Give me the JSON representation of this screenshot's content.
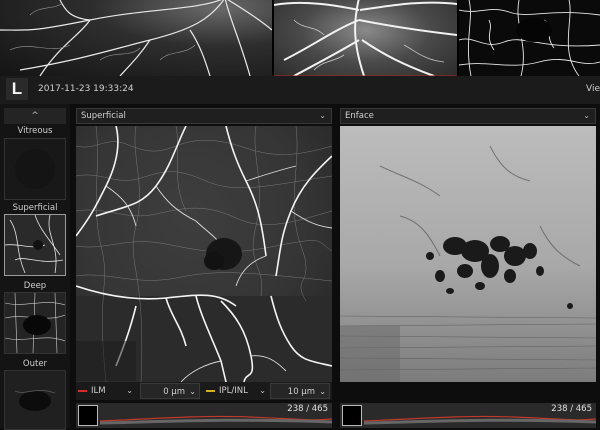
{
  "header": {
    "logo_letter": "L",
    "timestamp": "2017-11-23 19:33:24",
    "right_label": "Vie"
  },
  "sidebar": {
    "scroll_up_icon": "chevron-up-icon",
    "scroll_up_glyph": "^",
    "layers": [
      {
        "label": "Vitreous"
      },
      {
        "label": "Superficial",
        "selected": true
      },
      {
        "label": "Deep"
      },
      {
        "label": "Outer"
      }
    ]
  },
  "left_panel": {
    "dropdown_value": "Superficial",
    "chevron": "⌄"
  },
  "right_panel": {
    "dropdown_value": "Enface",
    "chevron": "⌄"
  },
  "controls": {
    "upper_layer": "ILM",
    "upper_layer_color": "#d12b2b",
    "upper_offset": "0 µm",
    "lower_layer": "IPL/INL",
    "lower_layer_color": "#d4b21e",
    "lower_offset": "10 µm",
    "chevron": "⌄"
  },
  "bscan_left": {
    "counter": "238 / 465"
  },
  "bscan_right": {
    "counter": "238 / 465"
  }
}
